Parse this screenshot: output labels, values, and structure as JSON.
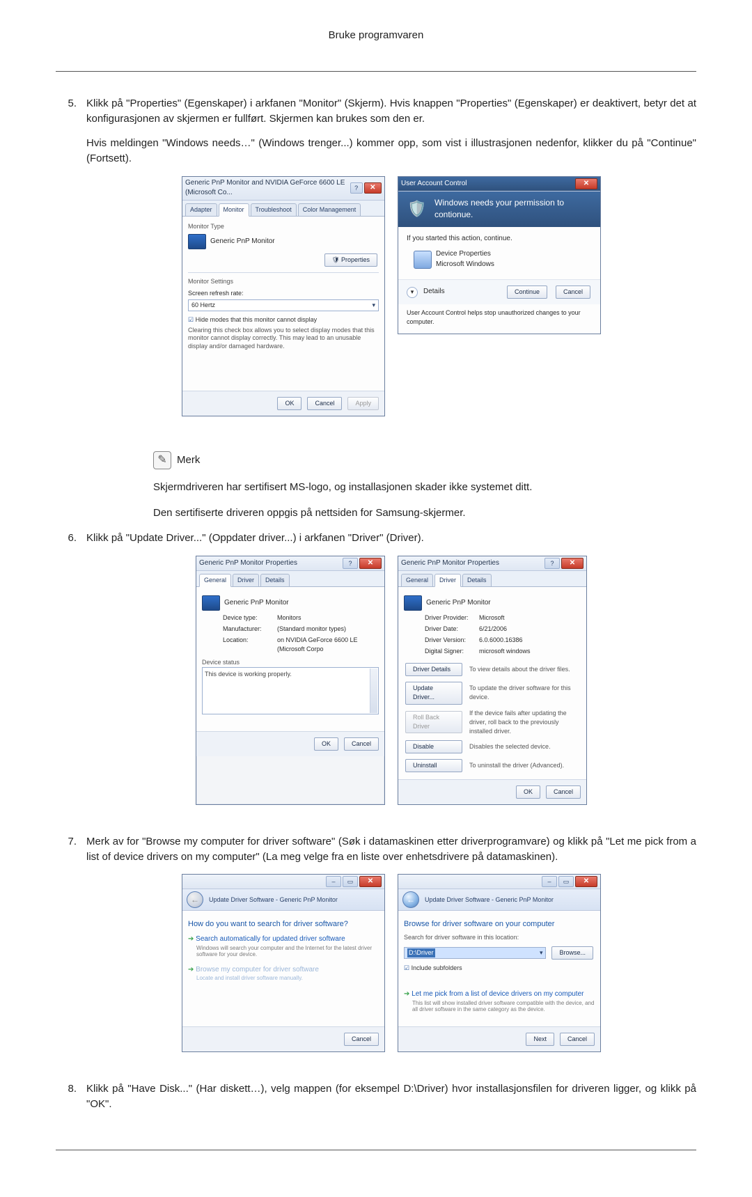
{
  "header": {
    "title": "Bruke programvaren"
  },
  "steps": {
    "s5": {
      "num": "5.",
      "p1": "Klikk på \"Properties\" (Egenskaper) i arkfanen \"Monitor\" (Skjerm). Hvis knappen \"Properties\" (Egenskaper) er deaktivert, betyr det at konfigurasjonen av skjermen er fullført. Skjermen kan brukes som den er.",
      "p2": "Hvis meldingen \"Windows needs…\" (Windows trenger...) kommer opp, som vist i illustrasjonen nedenfor, klikker du på \"Continue\" (Fortsett)."
    },
    "s6": {
      "num": "6.",
      "p1": "Klikk på \"Update Driver...\" (Oppdater driver...) i arkfanen \"Driver\" (Driver)."
    },
    "s7": {
      "num": "7.",
      "p1": "Merk av for \"Browse my computer for driver software\" (Søk i datamaskinen etter driverprogramvare) og klikk på \"Let me pick from a list of device drivers on my computer\" (La meg velge fra en liste over enhetsdrivere på datamaskinen)."
    },
    "s8": {
      "num": "8.",
      "p1": "Klikk på \"Have Disk...\" (Har diskett…), velg mappen (for eksempel D:\\Driver) hvor installasjonsfilen for driveren ligger, og klikk på \"OK\"."
    }
  },
  "note": {
    "label": "Merk",
    "p1": "Skjermdriveren har sertifisert MS-logo, og installasjonen skader ikke systemet ditt.",
    "p2": "Den sertifiserte driveren oppgis på nettsiden for Samsung-skjermer."
  },
  "fig1_monitor": {
    "title": "Generic PnP Monitor and NVIDIA GeForce 6600 LE (Microsoft Co...",
    "tabs": {
      "adapter": "Adapter",
      "monitor": "Monitor",
      "troubleshoot": "Troubleshoot",
      "color": "Color Management"
    },
    "monitor_type_label": "Monitor Type",
    "monitor_type_value": "Generic PnP Monitor",
    "properties_btn": "Properties",
    "settings_label": "Monitor Settings",
    "refresh_label": "Screen refresh rate:",
    "refresh_value": "60 Hertz",
    "hide_check": "Hide modes that this monitor cannot display",
    "hide_desc": "Clearing this check box allows you to select display modes that this monitor cannot display correctly. This may lead to an unusable display and/or damaged hardware.",
    "ok": "OK",
    "cancel": "Cancel",
    "apply": "Apply"
  },
  "fig1_uac": {
    "title": "User Account Control",
    "perm": "Windows needs your permission to contionue.",
    "started": "If you started this action, continue.",
    "dev_prop": "Device Properties",
    "ms_win": "Microsoft Windows",
    "details": "Details",
    "continue": "Continue",
    "cancel": "Cancel",
    "help": "User Account Control helps stop unauthorized changes to your computer."
  },
  "fig2_left": {
    "title": "Generic PnP Monitor Properties",
    "tabs": {
      "general": "General",
      "driver": "Driver",
      "details": "Details"
    },
    "name": "Generic PnP Monitor",
    "dev_type_l": "Device type:",
    "dev_type_v": "Monitors",
    "manu_l": "Manufacturer:",
    "manu_v": "(Standard monitor types)",
    "loc_l": "Location:",
    "loc_v": "on NVIDIA GeForce 6600 LE (Microsoft Corpo",
    "status_label": "Device status",
    "status_text": "This device is working properly.",
    "ok": "OK",
    "cancel": "Cancel"
  },
  "fig2_right": {
    "title": "Generic PnP Monitor Properties",
    "tabs": {
      "general": "General",
      "driver": "Driver",
      "details": "Details"
    },
    "name": "Generic PnP Monitor",
    "provider_l": "Driver Provider:",
    "provider_v": "Microsoft",
    "date_l": "Driver Date:",
    "date_v": "6/21/2006",
    "version_l": "Driver Version:",
    "version_v": "6.0.6000.16386",
    "signer_l": "Digital Signer:",
    "signer_v": "microsoft windows",
    "btn_details": "Driver Details",
    "desc_details": "To view details about the driver files.",
    "btn_update": "Update Driver...",
    "desc_update": "To update the driver software for this device.",
    "btn_rollback": "Roll Back Driver",
    "desc_rollback": "If the device fails after updating the driver, roll back to the previously installed driver.",
    "btn_disable": "Disable",
    "desc_disable": "Disables the selected device.",
    "btn_uninstall": "Uninstall",
    "desc_uninstall": "To uninstall the driver (Advanced).",
    "ok": "OK",
    "cancel": "Cancel"
  },
  "fig3_left": {
    "crumb": "Update Driver Software - Generic PnP Monitor",
    "heading": "How do you want to search for driver software?",
    "opt1_title": "Search automatically for updated driver software",
    "opt1_desc": "Windows will search your computer and the Internet for the latest driver software for your device.",
    "opt2_title": "Browse my computer for driver software",
    "opt2_desc": "Locate and install driver software manually.",
    "cancel": "Cancel"
  },
  "fig3_right": {
    "crumb": "Update Driver Software - Generic PnP Monitor",
    "heading": "Browse for driver software on your computer",
    "search_label": "Search for driver software in this location:",
    "path": "D:\\Driver",
    "browse": "Browse...",
    "include_sub": "Include subfolders",
    "opt_title": "Let me pick from a list of device drivers on my computer",
    "opt_desc": "This list will show installed driver software compatible with the device, and all driver software in the same category as the device.",
    "next": "Next",
    "cancel": "Cancel"
  }
}
